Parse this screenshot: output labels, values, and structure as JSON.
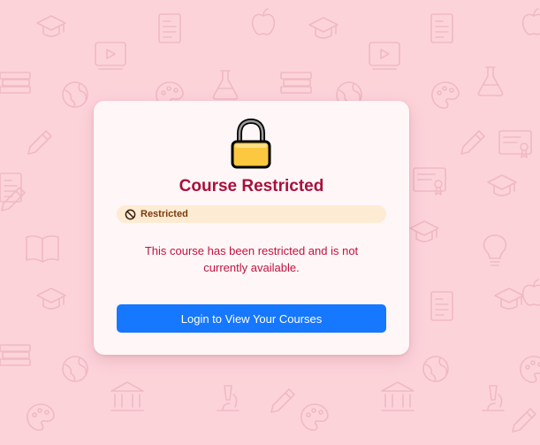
{
  "colors": {
    "background": "#fdd3da",
    "pattern": "#f0b9c3",
    "card": "#fff6f7",
    "title": "#a8103c",
    "badge_background": "#fdecd3",
    "badge_text": "#7b3b0c",
    "message": "#c0133f",
    "button": "#1677ff"
  },
  "background_icons": [
    "graduation-cap-icon",
    "document-icon",
    "apple-icon",
    "video-player-icon",
    "books-icon",
    "flask-icon",
    "globe-icon",
    "palette-icon",
    "pencil-icon",
    "certificate-icon",
    "open-book-icon",
    "lightbulb-icon",
    "bank-icon",
    "microscope-icon"
  ],
  "card": {
    "icon": "lock-icon",
    "title": "Course Restricted",
    "badge": {
      "icon": "prohibited-icon",
      "label": "Restricted"
    },
    "message": "This course has been restricted and is not currently available.",
    "button_label": "Login to View Your Courses"
  }
}
